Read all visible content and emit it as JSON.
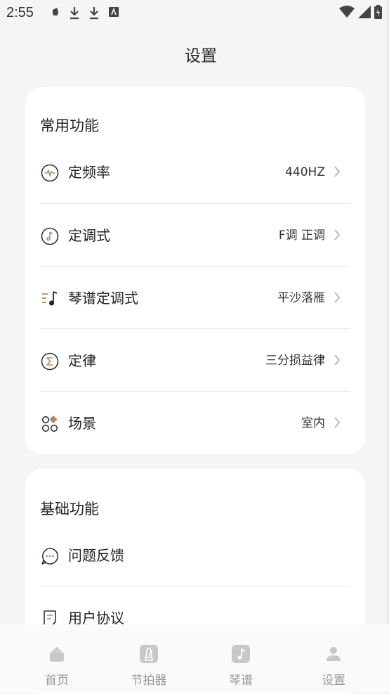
{
  "status_bar": {
    "time": "2:55"
  },
  "header": {
    "title": "设置"
  },
  "sections": [
    {
      "title": "常用功能",
      "items": [
        {
          "label": "定频率",
          "value": "440HZ",
          "icon": "frequency-icon"
        },
        {
          "label": "定调式",
          "value": "F调 正调",
          "icon": "music-note-icon"
        },
        {
          "label": "琴谱定调式",
          "value": "平沙落雁",
          "icon": "music-list-icon"
        },
        {
          "label": "定律",
          "value": "三分损益律",
          "icon": "sigma-icon"
        },
        {
          "label": "场景",
          "value": "室内",
          "icon": "scene-grid-icon"
        }
      ]
    },
    {
      "title": "基础功能",
      "items": [
        {
          "label": "问题反馈",
          "icon": "feedback-chat-icon"
        },
        {
          "label": "用户协议",
          "icon": "agreement-doc-icon"
        }
      ]
    }
  ],
  "tabbar": {
    "tabs": [
      {
        "label": "首页",
        "icon": "home-icon"
      },
      {
        "label": "节拍器",
        "icon": "metronome-icon"
      },
      {
        "label": "琴谱",
        "icon": "sheet-music-icon"
      },
      {
        "label": "设置",
        "icon": "user-icon"
      }
    ]
  },
  "colors": {
    "accent": "#b08d64",
    "background": "#f5f5f5",
    "card": "#ffffff",
    "tab_inactive": "#c8c8c8"
  }
}
